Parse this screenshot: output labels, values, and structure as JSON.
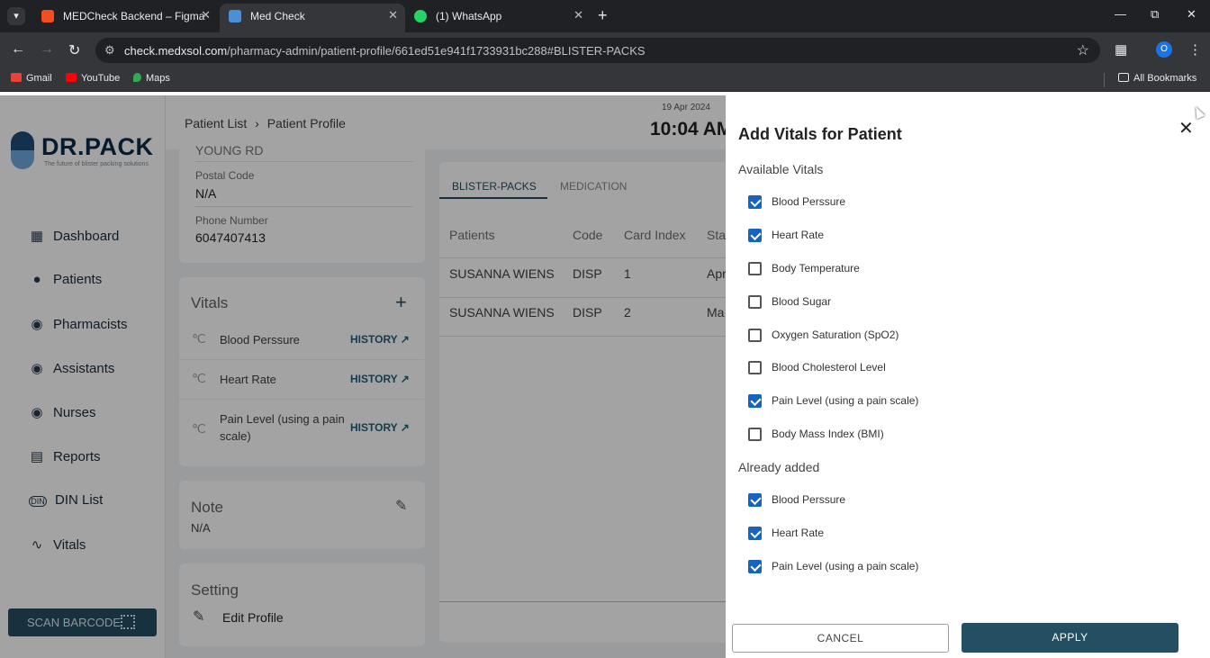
{
  "browser": {
    "tabs": [
      {
        "title": "MEDCheck Backend – Figma",
        "icon": "figma-icon",
        "color": "#f24e1e",
        "active": false
      },
      {
        "title": "Med Check",
        "icon": "medcheck-icon",
        "color": "#4a90d9",
        "active": true
      },
      {
        "title": "(1) WhatsApp",
        "icon": "whatsapp-icon",
        "color": "#25d366",
        "active": false
      }
    ],
    "url_host": "check.medxsol.com",
    "url_path": "/pharmacy-admin/patient-profile/661ed51e941f1733931bc288#BLISTER-PACKS",
    "profile_initial": "O",
    "bookmarks": [
      "Gmail",
      "YouTube",
      "Maps"
    ],
    "all_bookmarks": "All Bookmarks"
  },
  "sidebar": {
    "brand": "DR.PACK",
    "tagline": "The future of blister packing solutions",
    "items": [
      {
        "label": "Dashboard",
        "icon": "dashboard-icon"
      },
      {
        "label": "Patients",
        "icon": "person-icon"
      },
      {
        "label": "Pharmacists",
        "icon": "account-circle-icon"
      },
      {
        "label": "Assistants",
        "icon": "account-circle-icon"
      },
      {
        "label": "Nurses",
        "icon": "account-circle-icon"
      },
      {
        "label": "Reports",
        "icon": "clipboard-icon"
      },
      {
        "label": "DIN List",
        "icon": "din-icon"
      },
      {
        "label": "Vitals",
        "icon": "monitor-heart-icon"
      }
    ],
    "scan_button": "SCAN BARCODE"
  },
  "header": {
    "breadcrumb": [
      "Patient List",
      "Patient Profile"
    ],
    "date": "19 Apr 2024",
    "time": "10:04 AM"
  },
  "profile": {
    "address_partial": "YOUNG RD",
    "postal_label": "Postal Code",
    "postal_value": "N/A",
    "phone_label": "Phone Number",
    "phone_value": "6047407413",
    "vitals_title": "Vitals",
    "vitals": [
      {
        "name": "Blood Perssure",
        "action": "HISTORY"
      },
      {
        "name": "Heart Rate",
        "action": "HISTORY"
      },
      {
        "name": "Pain Level (using a pain scale)",
        "action": "HISTORY"
      }
    ],
    "note_title": "Note",
    "note_value": "N/A",
    "setting_title": "Setting",
    "edit_profile": "Edit Profile"
  },
  "packs": {
    "tabs": [
      "BLISTER-PACKS",
      "MEDICATION"
    ],
    "columns": [
      "Patients",
      "Code",
      "Card Index",
      "Sta"
    ],
    "rows": [
      [
        "SUSANNA WIENS",
        "DISP",
        "1",
        "Apr"
      ],
      [
        "SUSANNA WIENS",
        "DISP",
        "2",
        "Ma"
      ]
    ]
  },
  "drawer": {
    "title": "Add Vitals for Patient",
    "available_label": "Available Vitals",
    "available": [
      {
        "label": "Blood Perssure",
        "checked": true
      },
      {
        "label": "Heart Rate",
        "checked": true
      },
      {
        "label": "Body Temperature",
        "checked": false
      },
      {
        "label": "Blood Sugar",
        "checked": false
      },
      {
        "label": "Oxygen Saturation (SpO2)",
        "checked": false
      },
      {
        "label": "Blood Cholesterol Level",
        "checked": false
      },
      {
        "label": "Pain Level (using a pain scale)",
        "checked": true
      },
      {
        "label": "Body Mass Index (BMI)",
        "checked": false
      }
    ],
    "added_label": "Already added",
    "added": [
      {
        "label": "Blood Perssure",
        "checked": true
      },
      {
        "label": "Heart Rate",
        "checked": true
      },
      {
        "label": "Pain Level (using a pain scale)",
        "checked": true
      }
    ],
    "cancel": "CANCEL",
    "apply": "APPLY"
  },
  "colors": {
    "primary": "#244e62",
    "checkbox": "#1565c0",
    "link": "#1f5f7a"
  }
}
